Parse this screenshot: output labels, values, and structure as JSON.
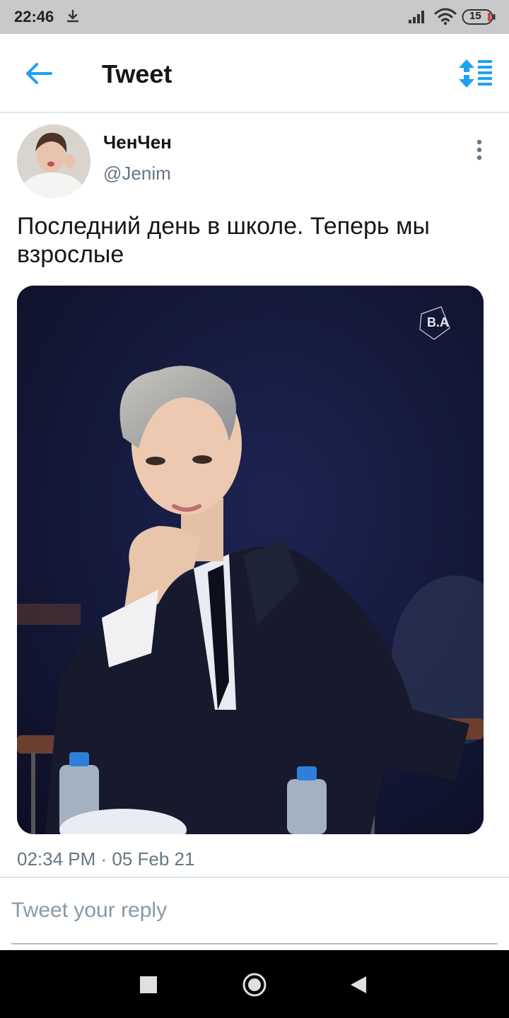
{
  "status_bar": {
    "time": "22:46",
    "battery": "15",
    "icons": [
      "download-icon",
      "signal-icon",
      "wifi-icon",
      "battery-icon"
    ]
  },
  "header": {
    "title": "Tweet",
    "back_icon": "arrow-left-icon",
    "sort_icon": "sort-list-icon"
  },
  "tweet": {
    "author_name": "ЧенЧен",
    "author_handle": "@Jenim",
    "text": "Последний день в школе. Теперь мы взрослые",
    "media_watermark": "B.A",
    "timestamp": "02:34 PM · 05 Feb 21"
  },
  "reply": {
    "placeholder": "Tweet your reply"
  },
  "nav_bar": {
    "icons": [
      "recents-square-icon",
      "home-circle-icon",
      "back-triangle-icon"
    ]
  },
  "colors": {
    "accent": "#1da1f2",
    "status_bar_bg": "#c9c9cb",
    "secondary_text": "#657786",
    "divider": "#e1e8ed"
  }
}
